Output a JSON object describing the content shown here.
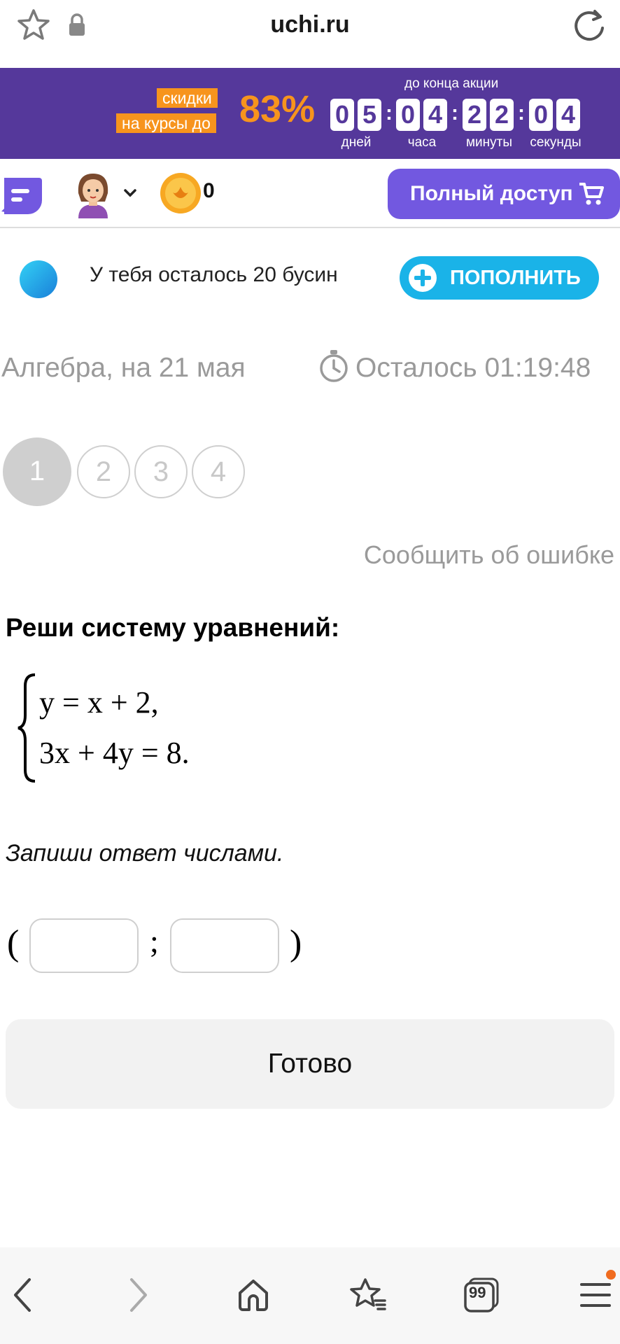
{
  "browser": {
    "url": "uchi.ru",
    "icons": [
      "star-icon",
      "lock-icon",
      "reload-icon"
    ]
  },
  "promo": {
    "label_line1": "скидки",
    "label_line2": "на курсы до",
    "percent": "83%",
    "until": "до конца акции",
    "digits": [
      "0",
      "5",
      "0",
      "4",
      "2",
      "2",
      "0",
      "4"
    ],
    "units": [
      "дней",
      "часа",
      "минуты",
      "секунды"
    ],
    "colors": {
      "background": "#55389b",
      "accent": "#f7941d"
    }
  },
  "header": {
    "coins": "0",
    "access_button": "Полный доступ",
    "access_color": "#7258e0"
  },
  "beads": {
    "text": "У тебя осталось 20 бусин",
    "refill_button": "ПОПОЛНИТЬ",
    "refill_color": "#1ab3e8"
  },
  "lesson": {
    "subject": "Алгебра, на 21 мая",
    "remaining": "Осталось 01:19:48",
    "steps": [
      "1",
      "2",
      "3",
      "4"
    ],
    "active_step": "1",
    "report": "Сообщить об ошибке"
  },
  "problem": {
    "title": "Реши систему уравнений:",
    "equation1": "y = x + 2,",
    "equation2": "3x + 4y = 8.",
    "hint": "Запиши ответ числами.",
    "open_paren": "(",
    "separator": ";",
    "close_paren": ")",
    "answer1": "",
    "answer2": ""
  },
  "done_button": "Готово",
  "bottom_bar": {
    "icons": [
      "back-icon",
      "forward-icon",
      "home-icon",
      "bookmarks-icon",
      "tabs-icon",
      "menu-icon"
    ],
    "tabs_count": "99"
  }
}
